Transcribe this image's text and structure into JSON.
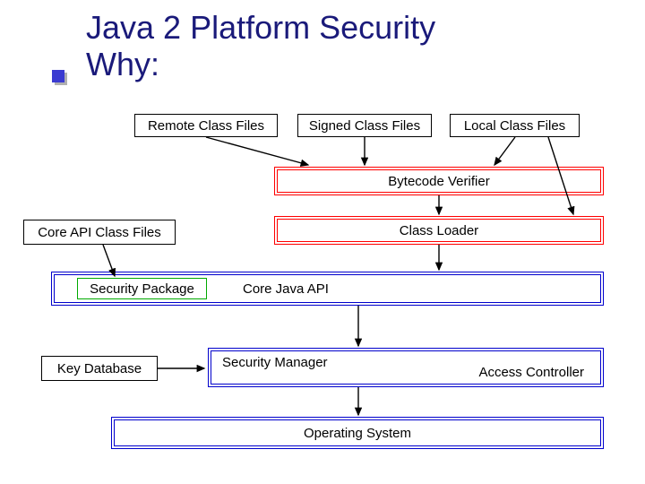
{
  "title": {
    "line1": "Java 2 Platform Security",
    "line2": "Why:"
  },
  "boxes": {
    "remote_class_files": "Remote Class Files",
    "signed_class_files": "Signed Class Files",
    "local_class_files": "Local Class Files",
    "bytecode_verifier": "Bytecode Verifier",
    "core_api_class_files": "Core API Class Files",
    "class_loader": "Class Loader",
    "security_package": "Security Package",
    "core_java_api": "Core Java API",
    "key_database": "Key Database",
    "security_manager": "Security Manager",
    "access_controller": "Access Controller",
    "operating_system": "Operating System"
  },
  "colors": {
    "title_color": "#1a1a7a",
    "red": "#f00",
    "blue": "#00c",
    "green": "#0a0"
  }
}
